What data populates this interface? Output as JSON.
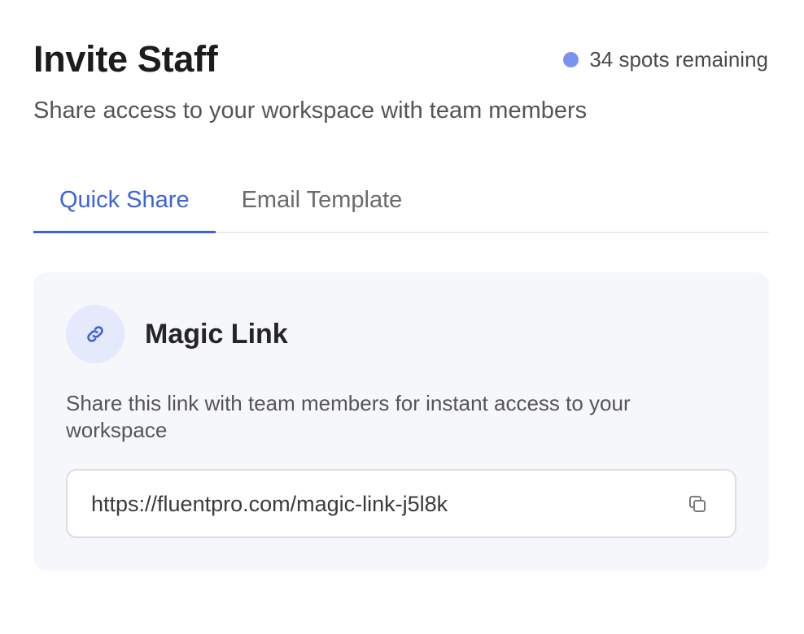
{
  "header": {
    "title": "Invite Staff",
    "spots_text": "34 spots remaining",
    "subtitle": "Share access to your workspace with team members"
  },
  "tabs": [
    {
      "label": "Quick Share",
      "active": true
    },
    {
      "label": "Email Template",
      "active": false
    }
  ],
  "magic_link": {
    "icon": "link-icon",
    "title": "Magic Link",
    "description": "Share this link with team members for instant access to your workspace",
    "url": "https://fluentpro.com/magic-link-j5l8k",
    "copy_icon": "copy-icon"
  },
  "colors": {
    "accent": "#3b63e0",
    "status_dot": "#7b93f0",
    "card_bg": "#f6f7fb",
    "icon_circle_bg": "#e4e9fb"
  }
}
